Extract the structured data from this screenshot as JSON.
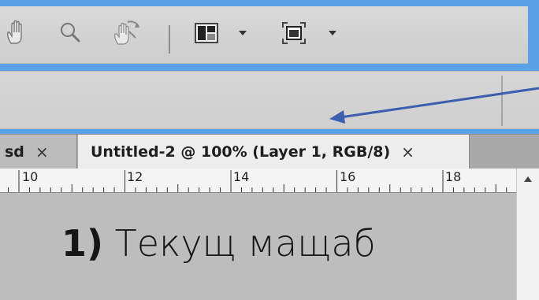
{
  "toolbar": {
    "icons": [
      "hand-tool-icon",
      "zoom-tool-icon",
      "rotate-view-icon",
      "arrange-documents-icon",
      "screen-mode-icon"
    ]
  },
  "tabs": [
    {
      "label": "sd",
      "active": false,
      "close": "×"
    },
    {
      "label": "Untitled-2 @ 100% (Layer 1, RGB/8)",
      "active": true,
      "close": "×"
    }
  ],
  "ruler": {
    "labels": [
      "10",
      "12",
      "14",
      "16",
      "18"
    ]
  },
  "caption": {
    "number": "1)",
    "text": " Текущ мащаб"
  },
  "colors": {
    "frame": "#5aa2e6",
    "arrow": "#3b5fae"
  }
}
